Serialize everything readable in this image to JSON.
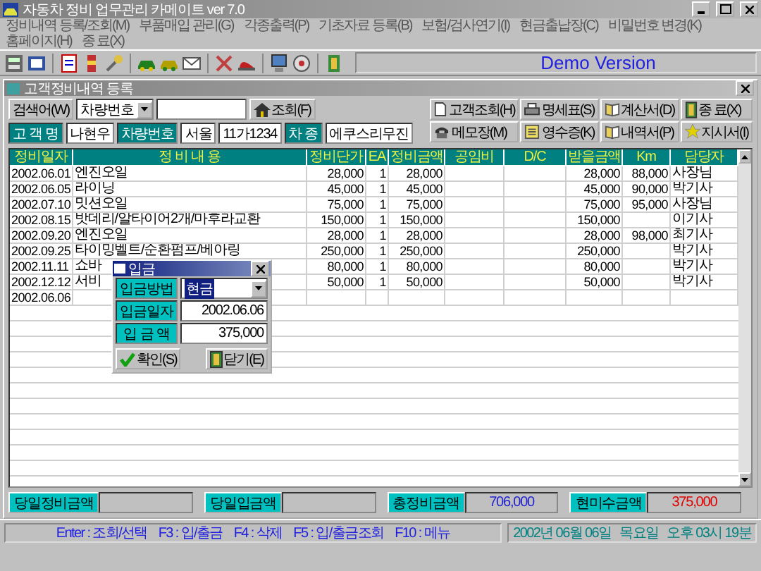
{
  "window": {
    "title": "자동차 정비 업무관리 카메이트 ver 7.0"
  },
  "menu": [
    "정비내역 등록/조회(M)",
    "부품매입 관리(G)",
    "각종출력(P)",
    "기초자료 등록(B)",
    "보험/검사연기(I)",
    "현금출납장(C)",
    "비밀번호 변경(K)",
    "홈페이지(H)",
    "종 료(X)"
  ],
  "toolbar": {
    "banner": "Demo Version"
  },
  "child_window": {
    "title": "고객정비내역 등록"
  },
  "search": {
    "button": "검색어(W)",
    "field_type": "차량번호",
    "search_button": "조회(F)"
  },
  "action_buttons": [
    {
      "label": "고객조회(H)",
      "kind": "page"
    },
    {
      "label": "명세표(S)",
      "kind": "printer"
    },
    {
      "label": "계산서(D)",
      "kind": "book"
    },
    {
      "label": "종 료(X)",
      "kind": "door"
    },
    {
      "label": "메모장(M)",
      "kind": "phone"
    },
    {
      "label": "영수증(K)",
      "kind": "receipt"
    },
    {
      "label": "내역서(P)",
      "kind": "book"
    },
    {
      "label": "지시서(I)",
      "kind": "star"
    }
  ],
  "customer": {
    "name_label": "고 객 명",
    "name": "나현우",
    "plate_label": "차량번호",
    "region": "서울",
    "plate": "11가1234",
    "model_label": "차 종",
    "model": "에쿠스리무진"
  },
  "table": {
    "columns": [
      "정비일자",
      "정 비 내 용",
      "정비단가",
      "EA",
      "정비금액",
      "공임비",
      "D/C",
      "받을금액",
      "Km",
      "담당자"
    ],
    "rows": [
      [
        "2002.06.01",
        "엔진오일",
        "28,000",
        "1",
        "28,000",
        "",
        "",
        "28,000",
        "88,000",
        "사장님"
      ],
      [
        "2002.06.05",
        "라이닝",
        "45,000",
        "1",
        "45,000",
        "",
        "",
        "45,000",
        "90,000",
        "박기사"
      ],
      [
        "2002.07.10",
        "밋션오일",
        "75,000",
        "1",
        "75,000",
        "",
        "",
        "75,000",
        "95,000",
        "사장님"
      ],
      [
        "2002.08.15",
        "밧데리/알타이어2개/마후라교환",
        "150,000",
        "1",
        "150,000",
        "",
        "",
        "150,000",
        "",
        "이기사"
      ],
      [
        "2002.09.20",
        "엔진오일",
        "28,000",
        "1",
        "28,000",
        "",
        "",
        "28,000",
        "98,000",
        "최기사"
      ],
      [
        "2002.09.25",
        "타이밍벨트/순환펌프/베아링",
        "250,000",
        "1",
        "250,000",
        "",
        "",
        "250,000",
        "",
        "박기사"
      ],
      [
        "2002.11.11",
        "쇼바",
        "80,000",
        "1",
        "80,000",
        "",
        "",
        "80,000",
        "",
        "박기사"
      ],
      [
        "2002.12.12",
        "서비",
        "50,000",
        "1",
        "50,000",
        "",
        "",
        "50,000",
        "",
        "박기사"
      ],
      [
        "2002.06.06",
        "",
        "",
        "",
        "",
        "",
        "",
        "",
        "",
        ""
      ]
    ]
  },
  "dialog": {
    "title": "입금",
    "fields": [
      {
        "label": "입금방법",
        "value": "현금",
        "kind": "combo"
      },
      {
        "label": "입금일자",
        "value": "2002.06.06",
        "kind": "text"
      },
      {
        "label": "입 금 액",
        "value": "375,000",
        "kind": "text"
      }
    ],
    "ok": "확인(S)",
    "close": "닫기(E)"
  },
  "totals": [
    {
      "label": "당일정비금액"
    },
    {
      "label": "당일입금액"
    },
    {
      "label": "총정비금액",
      "value": "706,000",
      "color": "#2020d0"
    },
    {
      "label": "현미수금액",
      "value": "375,000",
      "color": "#e00000"
    }
  ],
  "status_bar": {
    "keys": "Enter : 조회/선택    F3 : 입/출금    F4 : 삭제    F5 : 입/출금조회    F10 : 메뉴",
    "datetime": "2002년 06월 06일   목요일   오후 03시 19분"
  }
}
